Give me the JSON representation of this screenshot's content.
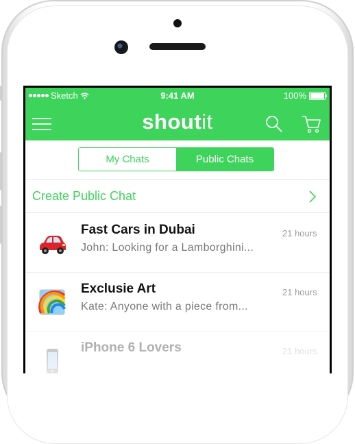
{
  "status_bar": {
    "carrier": "Sketch",
    "time": "9:41 AM",
    "battery": "100%"
  },
  "header": {
    "brand_bold": "shout",
    "brand_light": "it"
  },
  "tabs": [
    {
      "label": "My Chats",
      "selected": false
    },
    {
      "label": "Public Chats",
      "selected": true
    }
  ],
  "create_chat": {
    "label": "Create Public Chat"
  },
  "chats": [
    {
      "icon": "car-emoji-icon",
      "title": "Fast Cars in Dubai",
      "preview": "John: Looking for a Lamborghini...",
      "time": "21 hours"
    },
    {
      "icon": "rainbow-emoji-icon",
      "title": "Exclusie Art",
      "preview": "Kate: Anyone with a piece from...",
      "time": "21 hours"
    },
    {
      "icon": "phone-emoji-icon",
      "title": "iPhone 6 Lovers",
      "preview": "",
      "time": "21 hours"
    }
  ],
  "colors": {
    "accent": "#3ed45c",
    "text_dark": "#111111",
    "text_muted": "#7a7a7a"
  }
}
